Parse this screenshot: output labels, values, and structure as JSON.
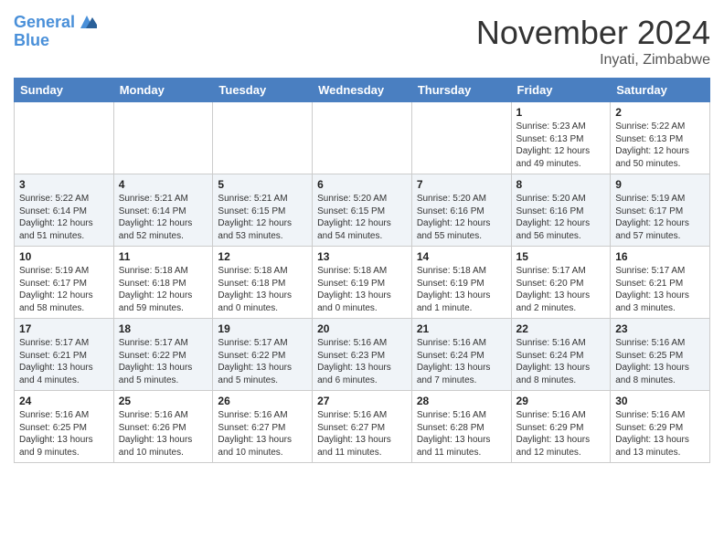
{
  "header": {
    "logo_line1": "General",
    "logo_line2": "Blue",
    "month": "November 2024",
    "location": "Inyati, Zimbabwe"
  },
  "columns": [
    "Sunday",
    "Monday",
    "Tuesday",
    "Wednesday",
    "Thursday",
    "Friday",
    "Saturday"
  ],
  "rows": [
    [
      {
        "day": "",
        "info": ""
      },
      {
        "day": "",
        "info": ""
      },
      {
        "day": "",
        "info": ""
      },
      {
        "day": "",
        "info": ""
      },
      {
        "day": "",
        "info": ""
      },
      {
        "day": "1",
        "info": "Sunrise: 5:23 AM\nSunset: 6:13 PM\nDaylight: 12 hours and 49 minutes."
      },
      {
        "day": "2",
        "info": "Sunrise: 5:22 AM\nSunset: 6:13 PM\nDaylight: 12 hours and 50 minutes."
      }
    ],
    [
      {
        "day": "3",
        "info": "Sunrise: 5:22 AM\nSunset: 6:14 PM\nDaylight: 12 hours and 51 minutes."
      },
      {
        "day": "4",
        "info": "Sunrise: 5:21 AM\nSunset: 6:14 PM\nDaylight: 12 hours and 52 minutes."
      },
      {
        "day": "5",
        "info": "Sunrise: 5:21 AM\nSunset: 6:15 PM\nDaylight: 12 hours and 53 minutes."
      },
      {
        "day": "6",
        "info": "Sunrise: 5:20 AM\nSunset: 6:15 PM\nDaylight: 12 hours and 54 minutes."
      },
      {
        "day": "7",
        "info": "Sunrise: 5:20 AM\nSunset: 6:16 PM\nDaylight: 12 hours and 55 minutes."
      },
      {
        "day": "8",
        "info": "Sunrise: 5:20 AM\nSunset: 6:16 PM\nDaylight: 12 hours and 56 minutes."
      },
      {
        "day": "9",
        "info": "Sunrise: 5:19 AM\nSunset: 6:17 PM\nDaylight: 12 hours and 57 minutes."
      }
    ],
    [
      {
        "day": "10",
        "info": "Sunrise: 5:19 AM\nSunset: 6:17 PM\nDaylight: 12 hours and 58 minutes."
      },
      {
        "day": "11",
        "info": "Sunrise: 5:18 AM\nSunset: 6:18 PM\nDaylight: 12 hours and 59 minutes."
      },
      {
        "day": "12",
        "info": "Sunrise: 5:18 AM\nSunset: 6:18 PM\nDaylight: 13 hours and 0 minutes."
      },
      {
        "day": "13",
        "info": "Sunrise: 5:18 AM\nSunset: 6:19 PM\nDaylight: 13 hours and 0 minutes."
      },
      {
        "day": "14",
        "info": "Sunrise: 5:18 AM\nSunset: 6:19 PM\nDaylight: 13 hours and 1 minute."
      },
      {
        "day": "15",
        "info": "Sunrise: 5:17 AM\nSunset: 6:20 PM\nDaylight: 13 hours and 2 minutes."
      },
      {
        "day": "16",
        "info": "Sunrise: 5:17 AM\nSunset: 6:21 PM\nDaylight: 13 hours and 3 minutes."
      }
    ],
    [
      {
        "day": "17",
        "info": "Sunrise: 5:17 AM\nSunset: 6:21 PM\nDaylight: 13 hours and 4 minutes."
      },
      {
        "day": "18",
        "info": "Sunrise: 5:17 AM\nSunset: 6:22 PM\nDaylight: 13 hours and 5 minutes."
      },
      {
        "day": "19",
        "info": "Sunrise: 5:17 AM\nSunset: 6:22 PM\nDaylight: 13 hours and 5 minutes."
      },
      {
        "day": "20",
        "info": "Sunrise: 5:16 AM\nSunset: 6:23 PM\nDaylight: 13 hours and 6 minutes."
      },
      {
        "day": "21",
        "info": "Sunrise: 5:16 AM\nSunset: 6:24 PM\nDaylight: 13 hours and 7 minutes."
      },
      {
        "day": "22",
        "info": "Sunrise: 5:16 AM\nSunset: 6:24 PM\nDaylight: 13 hours and 8 minutes."
      },
      {
        "day": "23",
        "info": "Sunrise: 5:16 AM\nSunset: 6:25 PM\nDaylight: 13 hours and 8 minutes."
      }
    ],
    [
      {
        "day": "24",
        "info": "Sunrise: 5:16 AM\nSunset: 6:25 PM\nDaylight: 13 hours and 9 minutes."
      },
      {
        "day": "25",
        "info": "Sunrise: 5:16 AM\nSunset: 6:26 PM\nDaylight: 13 hours and 10 minutes."
      },
      {
        "day": "26",
        "info": "Sunrise: 5:16 AM\nSunset: 6:27 PM\nDaylight: 13 hours and 10 minutes."
      },
      {
        "day": "27",
        "info": "Sunrise: 5:16 AM\nSunset: 6:27 PM\nDaylight: 13 hours and 11 minutes."
      },
      {
        "day": "28",
        "info": "Sunrise: 5:16 AM\nSunset: 6:28 PM\nDaylight: 13 hours and 11 minutes."
      },
      {
        "day": "29",
        "info": "Sunrise: 5:16 AM\nSunset: 6:29 PM\nDaylight: 13 hours and 12 minutes."
      },
      {
        "day": "30",
        "info": "Sunrise: 5:16 AM\nSunset: 6:29 PM\nDaylight: 13 hours and 13 minutes."
      }
    ]
  ]
}
